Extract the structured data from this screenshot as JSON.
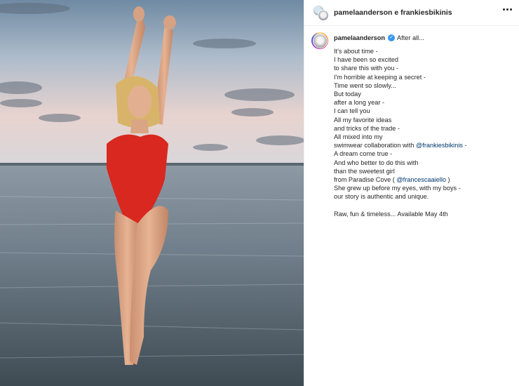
{
  "header": {
    "title": "pamelaanderson e frankiesbikinis",
    "avatars": [
      "avatar-pamelaanderson",
      "avatar-frankiesbikinis"
    ],
    "menu_icon": "more-horizontal-icon"
  },
  "caption": {
    "username": "pamelaanderson",
    "verified_icon": "verified-badge-icon",
    "first_line": "After all...",
    "lines": [
      {
        "text": "It's about time -"
      },
      {
        "text": "I have been so excited"
      },
      {
        "text": "to share this with you -"
      },
      {
        "text": "I'm horrible at keeping a secret -"
      },
      {
        "text": "Time went so slowly..."
      },
      {
        "text": "But today"
      },
      {
        "text": "after a long year -"
      },
      {
        "text": "I can tell you"
      },
      {
        "text": "All my favorite ideas"
      },
      {
        "text": "and tricks of the trade -"
      },
      {
        "text": "All mixed into my"
      },
      {
        "pre": "swimwear collaboration with ",
        "mention": "@frankiesbikinis",
        "post": " -"
      },
      {
        "text": "A dream come true -"
      },
      {
        "text": "And who better to do this with"
      },
      {
        "text": "than the sweetest girl"
      },
      {
        "pre": "from Paradise Cove ( ",
        "mention": "@francescaaiello",
        "post": " )"
      },
      {
        "text": "She grew up before my eyes, with my boys -"
      },
      {
        "text": "our story is authentic and unique."
      }
    ],
    "closing": "Raw, fun & timeless... Available May 4th"
  },
  "colors": {
    "swimsuit": "#d8281f",
    "mention": "#00376b",
    "verified": "#3897f0"
  }
}
